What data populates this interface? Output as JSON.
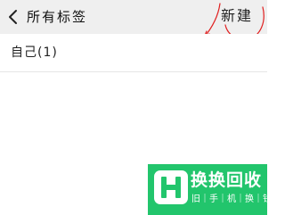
{
  "header": {
    "title": "所有标签",
    "new_label": "新建"
  },
  "tags": [
    {
      "label": "自己(1)"
    }
  ],
  "watermark": {
    "title": "换换回收",
    "subtitle": "旧｜手｜机｜换｜钱"
  },
  "colors": {
    "header_bg": "#efefef",
    "annotation": "#e02020",
    "watermark_bg": "#22c56c"
  }
}
